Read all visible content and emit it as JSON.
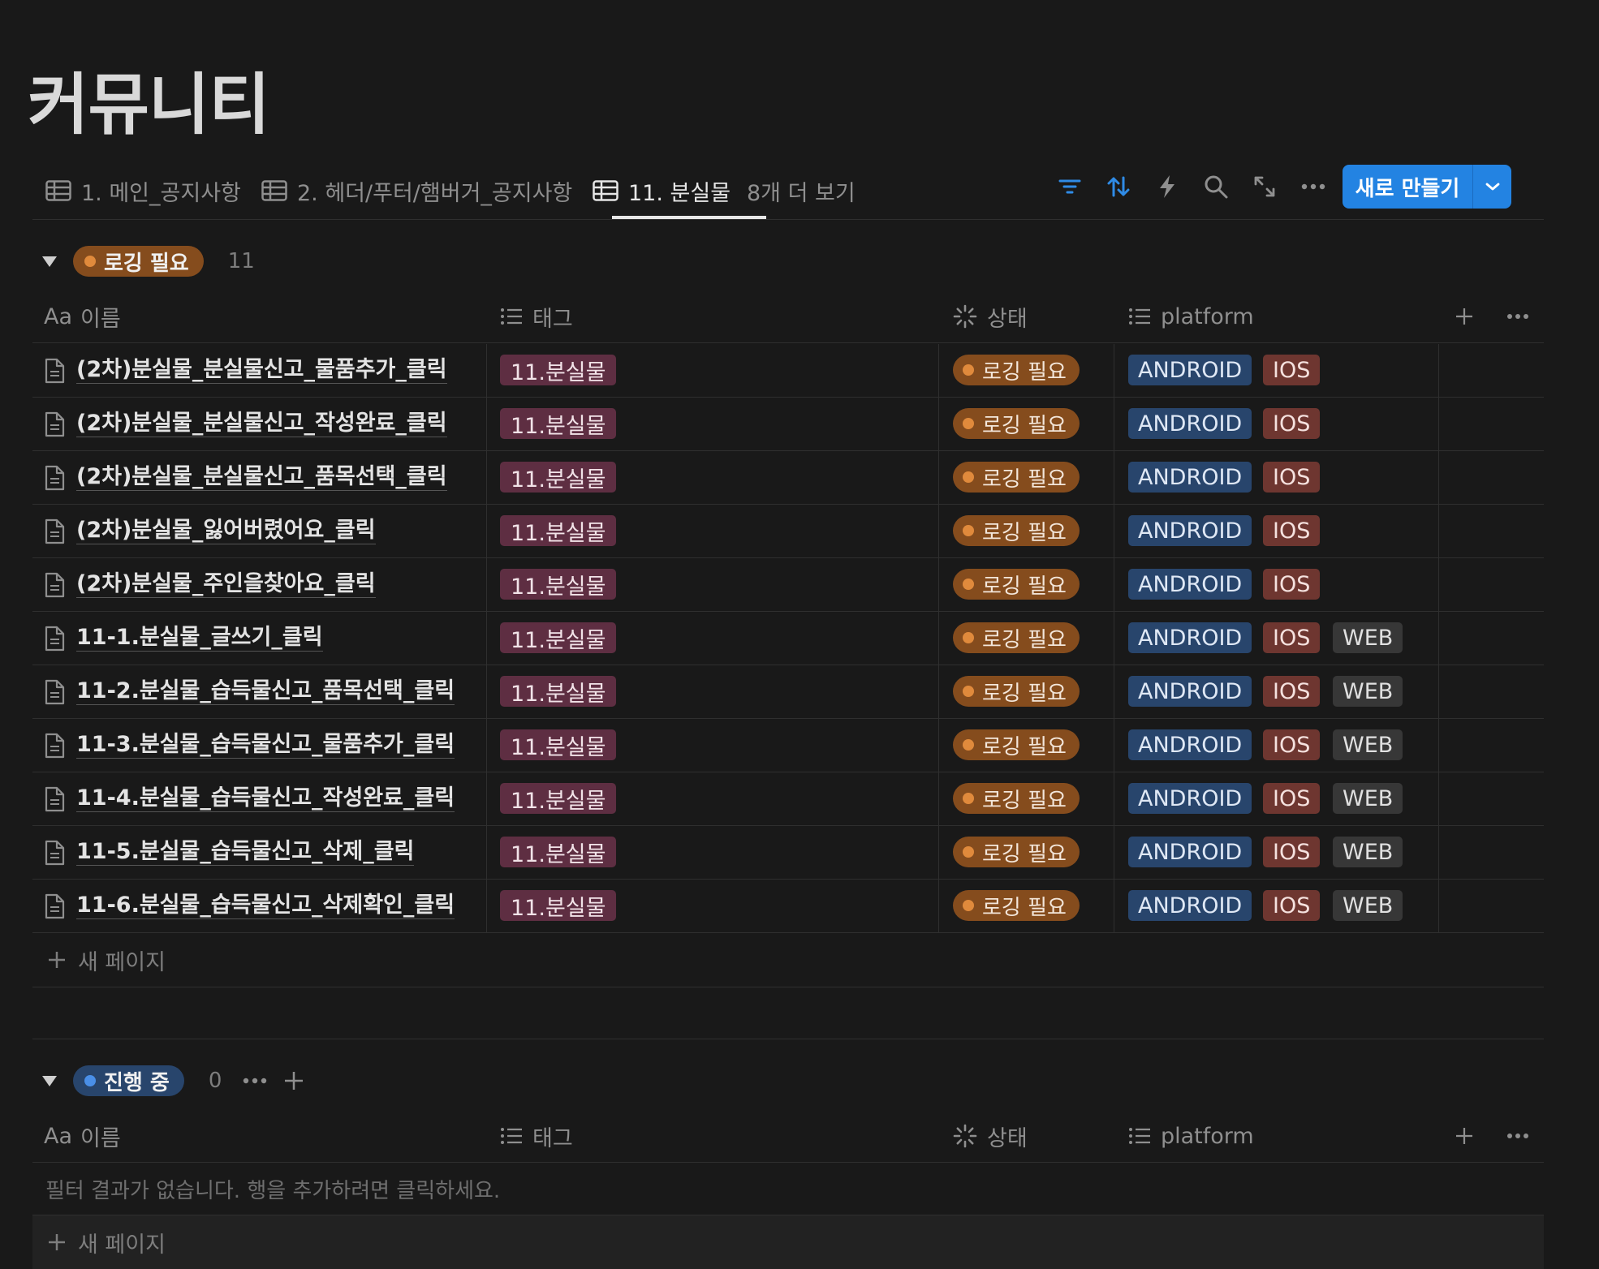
{
  "page": {
    "title": "커뮤니티"
  },
  "tabs": [
    {
      "label": "1. 메인_공지사항"
    },
    {
      "label": "2. 헤더/푸터/햄버거_공지사항"
    },
    {
      "label": "11. 분실물"
    }
  ],
  "more_tabs_label": "8개 더 보기",
  "toolbar": {
    "icons": [
      "filter-icon",
      "sort-icon",
      "automation-icon",
      "search-icon",
      "expand-icon",
      "more-icon"
    ],
    "new_button_label": "새로 만들기"
  },
  "columns": {
    "name": "이름",
    "name_prefix": "Aa",
    "tag": "태그",
    "status": "상태",
    "platform": "platform"
  },
  "groups": [
    {
      "status": "로깅 필요",
      "count": "11",
      "color": "#854c1d",
      "dot_color": "#e08a3c",
      "rows": [
        {
          "name": "(2차)분실물_분실물신고_물품추가_클릭",
          "tag": "11.분실물",
          "status": "로깅 필요",
          "platforms": [
            "ANDROID",
            "IOS"
          ]
        },
        {
          "name": "(2차)분실물_분실물신고_작성완료_클릭",
          "tag": "11.분실물",
          "status": "로깅 필요",
          "platforms": [
            "ANDROID",
            "IOS"
          ]
        },
        {
          "name": "(2차)분실물_분실물신고_품목선택_클릭",
          "tag": "11.분실물",
          "status": "로깅 필요",
          "platforms": [
            "ANDROID",
            "IOS"
          ]
        },
        {
          "name": "(2차)분실물_잃어버렸어요_클릭",
          "tag": "11.분실물",
          "status": "로깅 필요",
          "platforms": [
            "ANDROID",
            "IOS"
          ]
        },
        {
          "name": "(2차)분실물_주인을찾아요_클릭",
          "tag": "11.분실물",
          "status": "로깅 필요",
          "platforms": [
            "ANDROID",
            "IOS"
          ]
        },
        {
          "name": "11-1.분실물_글쓰기_클릭",
          "tag": "11.분실물",
          "status": "로깅 필요",
          "platforms": [
            "ANDROID",
            "IOS",
            "WEB"
          ]
        },
        {
          "name": "11-2.분실물_습득물신고_품목선택_클릭",
          "tag": "11.분실물",
          "status": "로깅 필요",
          "platforms": [
            "ANDROID",
            "IOS",
            "WEB"
          ]
        },
        {
          "name": "11-3.분실물_습득물신고_물품추가_클릭",
          "tag": "11.분실물",
          "status": "로깅 필요",
          "platforms": [
            "ANDROID",
            "IOS",
            "WEB"
          ]
        },
        {
          "name": "11-4.분실물_습득물신고_작성완료_클릭",
          "tag": "11.분실물",
          "status": "로깅 필요",
          "platforms": [
            "ANDROID",
            "IOS",
            "WEB"
          ]
        },
        {
          "name": "11-5.분실물_습득물신고_삭제_클릭",
          "tag": "11.분실물",
          "status": "로깅 필요",
          "platforms": [
            "ANDROID",
            "IOS",
            "WEB"
          ]
        },
        {
          "name": "11-6.분실물_습득물신고_삭제확인_클릭",
          "tag": "11.분실물",
          "status": "로깅 필요",
          "platforms": [
            "ANDROID",
            "IOS",
            "WEB"
          ]
        }
      ]
    },
    {
      "status": "진행 중",
      "count": "0",
      "color": "#28456c",
      "dot_color": "#4a8fe7",
      "rows": []
    }
  ],
  "new_page_label": "새 페이지",
  "empty_message": "필터 결과가 없습니다. 행을 추가하려면 클릭하세요."
}
